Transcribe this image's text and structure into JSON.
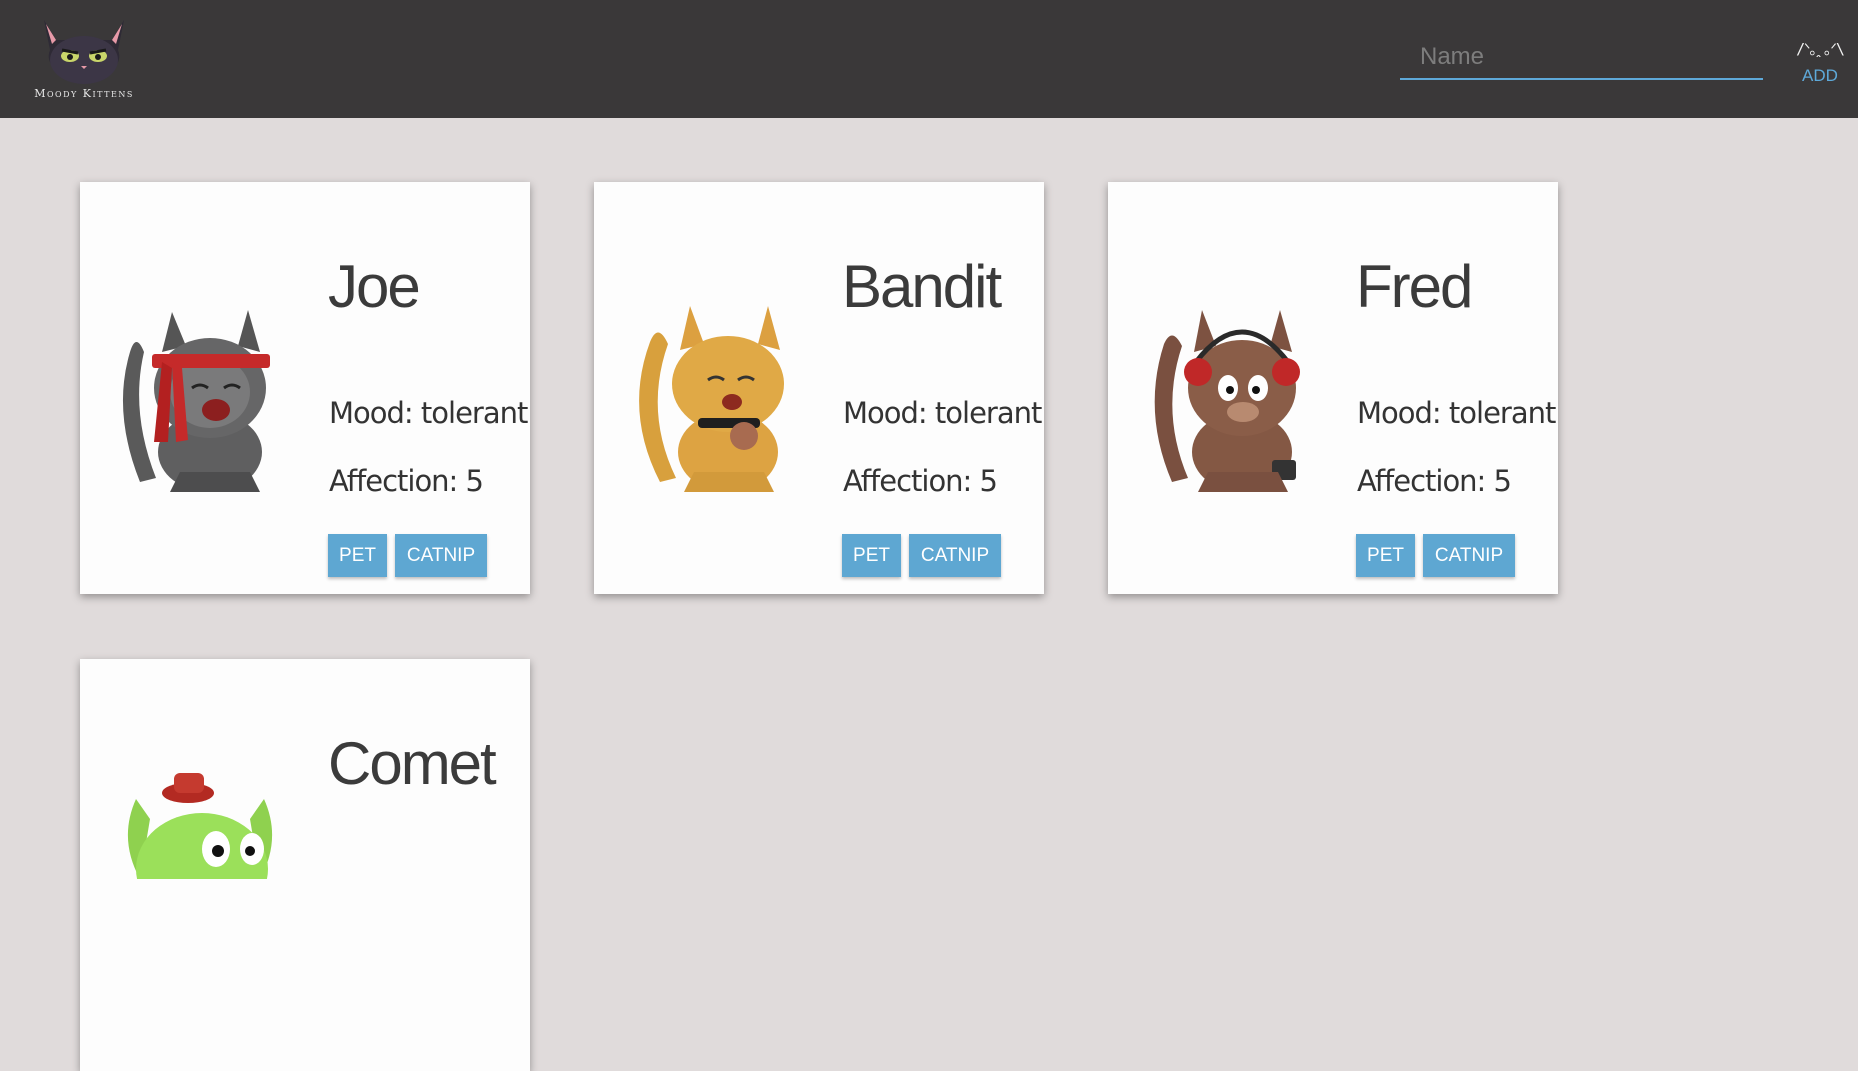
{
  "header": {
    "logo_text": "Moody Kittens",
    "name_input": {
      "placeholder": "Name",
      "value": ""
    },
    "add_button": {
      "face": "/ᐠ｡ꞈ｡ᐟ\\",
      "label": "ADD"
    },
    "accent_color": "#5ea9d9"
  },
  "kittens": [
    {
      "name": "Joe",
      "mood": "Mood: tolerant",
      "affection": "Affection: 5",
      "pet_label": "PET",
      "catnip_label": "CATNIP",
      "image": "gray-cat-red-headband-icon"
    },
    {
      "name": "Bandit",
      "mood": "Mood: tolerant",
      "affection": "Affection: 5",
      "pet_label": "PET",
      "catnip_label": "CATNIP",
      "image": "orange-cat-collar-icon"
    },
    {
      "name": "Fred",
      "mood": "Mood: tolerant",
      "affection": "Affection: 5",
      "pet_label": "PET",
      "catnip_label": "CATNIP",
      "image": "brown-cat-headphones-icon"
    },
    {
      "name": "Comet",
      "mood": "",
      "affection": "",
      "pet_label": "",
      "catnip_label": "",
      "image": "green-cat-red-hat-icon"
    }
  ]
}
